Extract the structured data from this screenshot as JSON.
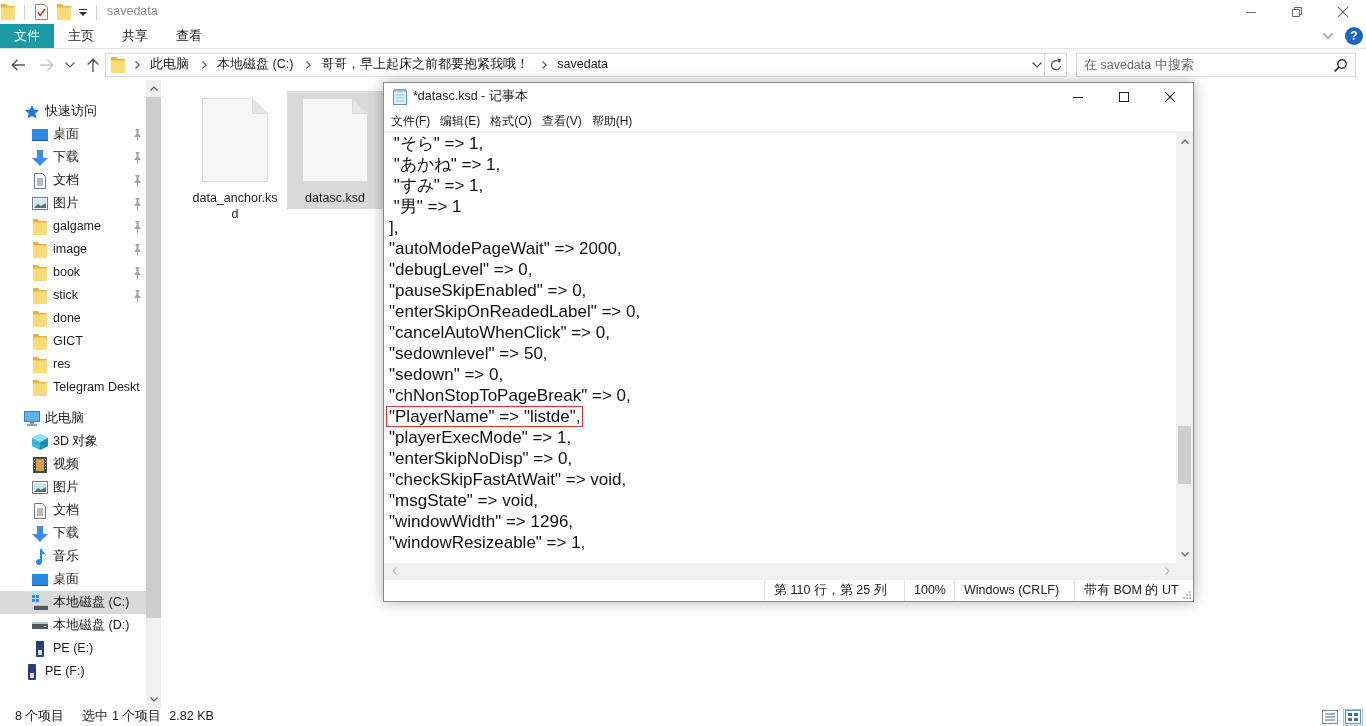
{
  "explorer": {
    "title": "savedata",
    "ribbon_tabs": [
      {
        "label": "文件",
        "selected": true
      },
      {
        "label": "主页",
        "selected": false
      },
      {
        "label": "共享",
        "selected": false
      },
      {
        "label": "查看",
        "selected": false
      }
    ],
    "help_button": {
      "label": "?"
    },
    "nav_buttons": [
      {
        "kind": "back",
        "disabled": false
      },
      {
        "kind": "forward",
        "disabled": true
      },
      {
        "kind": "recent",
        "disabled": false
      },
      {
        "kind": "up",
        "disabled": false
      }
    ],
    "breadcrumbs": [
      "此电脑",
      "本地磁盘 (C:)",
      "哥哥，早上起床之前都要抱紧我哦！",
      "savedata"
    ],
    "search": {
      "placeholder": "在 savedata 中搜索"
    },
    "navigation": [
      {
        "label": "快速访问",
        "kind": "star",
        "selected": false,
        "children": [
          {
            "label": "桌面",
            "kind": "desktop",
            "pinned": true,
            "selected": false
          },
          {
            "label": "下载",
            "kind": "downloads",
            "pinned": true,
            "selected": false
          },
          {
            "label": "文档",
            "kind": "documents",
            "pinned": true,
            "selected": false
          },
          {
            "label": "图片",
            "kind": "pictures",
            "pinned": true,
            "selected": false
          },
          {
            "label": "galgame",
            "kind": "folder",
            "pinned": true,
            "selected": false
          },
          {
            "label": "image",
            "kind": "folder",
            "pinned": true,
            "selected": false
          },
          {
            "label": "book",
            "kind": "folder",
            "pinned": true,
            "selected": false
          },
          {
            "label": "stick",
            "kind": "folder",
            "pinned": true,
            "selected": false
          },
          {
            "label": "done",
            "kind": "folder",
            "pinned": false,
            "selected": false
          },
          {
            "label": "GICT",
            "kind": "folder",
            "pinned": false,
            "selected": false
          },
          {
            "label": "res",
            "kind": "folder",
            "pinned": false,
            "selected": false
          },
          {
            "label": "Telegram Deskt",
            "kind": "folder",
            "pinned": false,
            "selected": false
          }
        ]
      },
      {
        "label": "此电脑",
        "kind": "computer",
        "selected": false,
        "children": [
          {
            "label": "3D 对象",
            "kind": "objects",
            "selected": false
          },
          {
            "label": "视频",
            "kind": "videos",
            "selected": false
          },
          {
            "label": "图片",
            "kind": "pictures",
            "selected": false
          },
          {
            "label": "文档",
            "kind": "documents",
            "selected": false
          },
          {
            "label": "下载",
            "kind": "downloads",
            "selected": false
          },
          {
            "label": "音乐",
            "kind": "music",
            "selected": false
          },
          {
            "label": "桌面",
            "kind": "desktop",
            "selected": false
          },
          {
            "label": "本地磁盘 (C:)",
            "kind": "systemdrive",
            "selected": true
          },
          {
            "label": "本地磁盘 (D:)",
            "kind": "drive",
            "selected": false
          },
          {
            "label": "PE (E:)",
            "kind": "removable",
            "selected": false
          }
        ]
      },
      {
        "label": "PE (F:)",
        "kind": "removable",
        "selected": false
      }
    ],
    "files": [
      {
        "name": "data_anchor.ksd",
        "selected": false
      },
      {
        "name": "datasc.ksd",
        "selected": true
      }
    ],
    "status_bar": {
      "item_count": "8 个项目",
      "selection": "选中 1 个项目",
      "size": "2.82 KB"
    },
    "view_buttons": [
      {
        "kind": "details",
        "selected": false
      },
      {
        "kind": "icons",
        "selected": true
      }
    ]
  },
  "notepad": {
    "title": "*datasc.ksd - 记事本",
    "menu": [
      "文件(F)",
      "编辑(E)",
      "格式(O)",
      "查看(V)",
      "帮助(H)"
    ],
    "lines": [
      {
        "text": " \"そら\" => 1,",
        "highlighted": false
      },
      {
        "text": " \"あかね\" => 1,",
        "highlighted": false
      },
      {
        "text": " \"すみ\" => 1,",
        "highlighted": false
      },
      {
        "text": " \"男\" => 1",
        "highlighted": false
      },
      {
        "text": "],",
        "highlighted": false
      },
      {
        "text": "\"autoModePageWait\" => 2000,",
        "highlighted": false
      },
      {
        "text": "\"debugLevel\" => 0,",
        "highlighted": false
      },
      {
        "text": "\"pauseSkipEnabled\" => 0,",
        "highlighted": false
      },
      {
        "text": "\"enterSkipOnReadedLabel\" => 0,",
        "highlighted": false
      },
      {
        "text": "\"cancelAutoWhenClick\" => 0,",
        "highlighted": false
      },
      {
        "text": "\"sedownlevel\" => 50,",
        "highlighted": false
      },
      {
        "text": "\"sedown\" => 0,",
        "highlighted": false
      },
      {
        "text": "\"chNonStopToPageBreak\" => 0,",
        "highlighted": false
      },
      {
        "text": "\"PlayerName\" => \"listde\",",
        "highlighted": true
      },
      {
        "text": "\"playerExecMode\" => 1,",
        "highlighted": false
      },
      {
        "text": "\"enterSkipNoDisp\" => 0,",
        "highlighted": false
      },
      {
        "text": "\"checkSkipFastAtWait\" => void,",
        "highlighted": false
      },
      {
        "text": "\"msgState\" => void,",
        "highlighted": false
      },
      {
        "text": "\"windowWidth\" => 1296,",
        "highlighted": false
      },
      {
        "text": "\"windowResizeable\" => 1,",
        "highlighted": false
      }
    ],
    "status_bar": {
      "position": "第 110 行，第 25 列",
      "zoom": "100%",
      "line_ending": "Windows (CRLF)",
      "encoding": "带有 BOM 的 UT"
    }
  }
}
